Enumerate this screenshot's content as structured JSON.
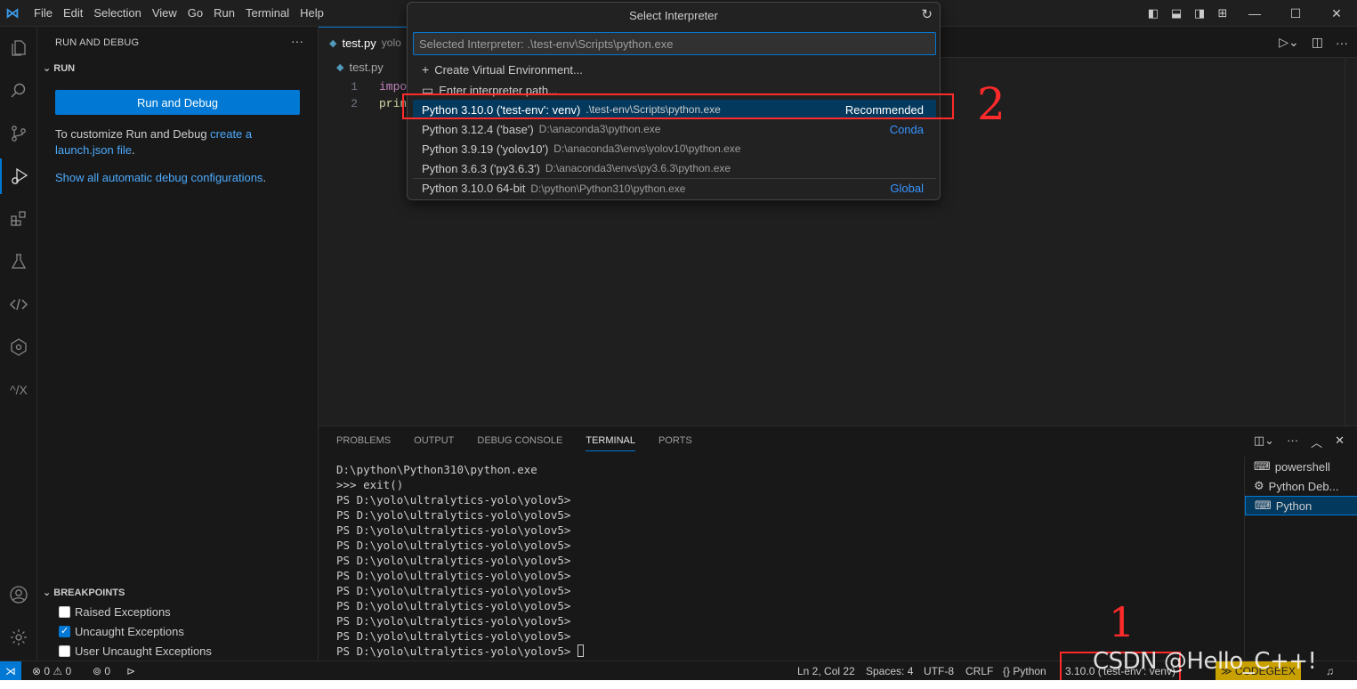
{
  "menu": [
    "File",
    "Edit",
    "Selection",
    "View",
    "Go",
    "Run",
    "Terminal",
    "Help"
  ],
  "sidebar": {
    "title": "RUN AND DEBUG",
    "run_section": "RUN",
    "run_button": "Run and Debug",
    "customize_text": "To customize Run and Debug ",
    "customize_link": "create a launch.json file",
    "customize_end": ".",
    "show_all_link": "Show all automatic debug configurations",
    "show_all_end": ".",
    "breakpoints_section": "BREAKPOINTS",
    "breakpoints": [
      {
        "label": "Raised Exceptions",
        "checked": false
      },
      {
        "label": "Uncaught Exceptions",
        "checked": true
      },
      {
        "label": "User Uncaught Exceptions",
        "checked": false
      }
    ]
  },
  "editor": {
    "tab_label": "test.py",
    "tab_path": "yolo",
    "breadcrumb": "test.py",
    "lines": [
      {
        "num": "1",
        "code": "impo"
      },
      {
        "num": "2",
        "code": "prin"
      }
    ]
  },
  "quickpick": {
    "title": "Select Interpreter",
    "placeholder": "Selected Interpreter: .\\test-env\\Scripts\\python.exe",
    "actions": [
      {
        "label": "Create Virtual Environment...",
        "icon": "plus-icon"
      },
      {
        "label": "Enter interpreter path...",
        "icon": "folder-icon"
      }
    ],
    "items": [
      {
        "label": "Python 3.10.0 ('test-env': venv)",
        "desc": ".\\test-env\\Scripts\\python.exe",
        "tag": "Recommended"
      },
      {
        "label": "Python 3.12.4 ('base')",
        "desc": "D:\\anaconda3\\python.exe",
        "tag": "Conda"
      },
      {
        "label": "Python 3.9.19 ('yolov10')",
        "desc": "D:\\anaconda3\\envs\\yolov10\\python.exe",
        "tag": ""
      },
      {
        "label": "Python 3.6.3 ('py3.6.3')",
        "desc": "D:\\anaconda3\\envs\\py3.6.3\\python.exe",
        "tag": ""
      },
      {
        "label": "Python 3.10.0 64-bit",
        "desc": "D:\\python\\Python310\\python.exe",
        "tag": "Global"
      }
    ]
  },
  "panel": {
    "tabs": [
      "PROBLEMS",
      "OUTPUT",
      "DEBUG CONSOLE",
      "TERMINAL",
      "PORTS"
    ],
    "active_tab": "TERMINAL",
    "terminal_lines": [
      "D:\\python\\Python310\\python.exe",
      ">>> exit()",
      "PS D:\\yolo\\ultralytics-yolo\\yolov5>",
      "PS D:\\yolo\\ultralytics-yolo\\yolov5>",
      "PS D:\\yolo\\ultralytics-yolo\\yolov5>",
      "PS D:\\yolo\\ultralytics-yolo\\yolov5>",
      "PS D:\\yolo\\ultralytics-yolo\\yolov5>",
      "PS D:\\yolo\\ultralytics-yolo\\yolov5>",
      "PS D:\\yolo\\ultralytics-yolo\\yolov5>",
      "PS D:\\yolo\\ultralytics-yolo\\yolov5>",
      "PS D:\\yolo\\ultralytics-yolo\\yolov5>",
      "PS D:\\yolo\\ultralytics-yolo\\yolov5>",
      "PS D:\\yolo\\ultralytics-yolo\\yolov5> "
    ],
    "terminals": [
      {
        "label": "powershell",
        "icon": "terminal-icon"
      },
      {
        "label": "Python Deb...",
        "icon": "debug-icon"
      },
      {
        "label": "Python",
        "icon": "terminal-icon"
      }
    ]
  },
  "status": {
    "errors": "0",
    "warnings": "0",
    "ports": "0",
    "position": "Ln 2, Col 22",
    "spaces": "Spaces: 4",
    "encoding": "UTF-8",
    "eol": "CRLF",
    "language": "Python",
    "interpreter": "3.10.0 ('test-env': venv)",
    "codegeex": "CODEGEEX"
  },
  "annotations": {
    "one": "1",
    "two": "2"
  },
  "watermark": "CSDN @Hello_C++!",
  "colors": {
    "accent": "#0078d4",
    "annotation": "#ff2a2a",
    "selected": "#04395e"
  }
}
